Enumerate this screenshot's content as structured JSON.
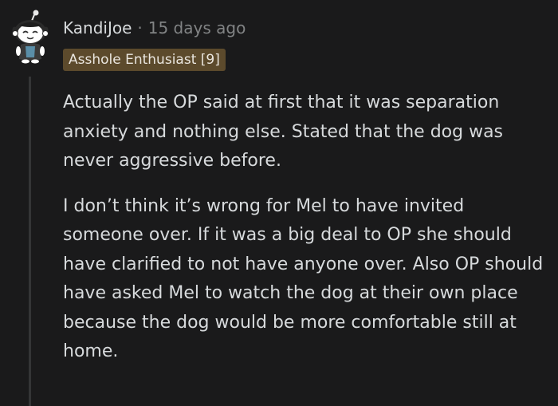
{
  "comment": {
    "author": "KandiJoe",
    "separator": "·",
    "timestamp": "15 days ago",
    "flair": "Asshole Enthusiast [9]",
    "avatar_icon": "snoo-avatar-icon",
    "flair_color": "#5c4a2c",
    "paragraphs": [
      "Actually the OP said at first that it was separation anxiety and nothing else. Stated that the dog was never aggressive before.",
      "I don’t think it’s wrong for Mel to have invited someone over. If it was a big deal to OP she should have clarified to not have anyone over. Also OP should have asked Mel to watch the dog at their own place because the dog would be more comfortable still at home."
    ]
  }
}
